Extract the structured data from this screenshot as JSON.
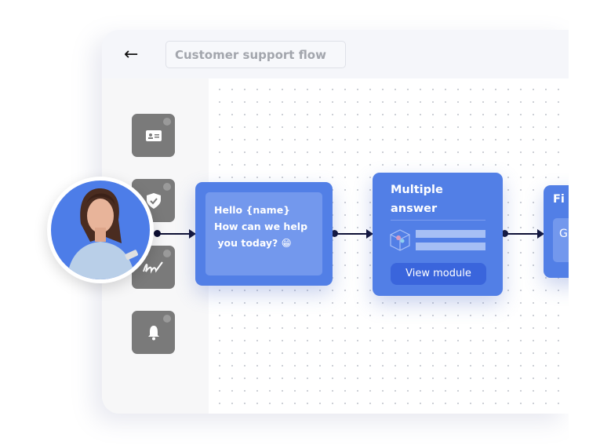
{
  "header": {
    "back_icon": "arrow-left-icon",
    "title": "Customer support flow"
  },
  "sidebar": {
    "tiles": [
      {
        "icon": "id-card-icon"
      },
      {
        "icon": "shield-check-icon"
      },
      {
        "icon": "signature-icon"
      },
      {
        "icon": "bell-icon"
      }
    ]
  },
  "nodes": [
    {
      "lines": [
        "Hello {name}",
        "How can we help",
        " you today? 😁"
      ]
    },
    {
      "title_lines": [
        "Multiple",
        "answer"
      ],
      "button": "View module",
      "icon": "cube-icon"
    },
    {
      "title": "Fi",
      "inner": "G"
    }
  ],
  "colors": {
    "card": "#527fe6",
    "inner": "#7398ed",
    "arrow": "#0d0f33",
    "tile": "#7a7a7a"
  }
}
